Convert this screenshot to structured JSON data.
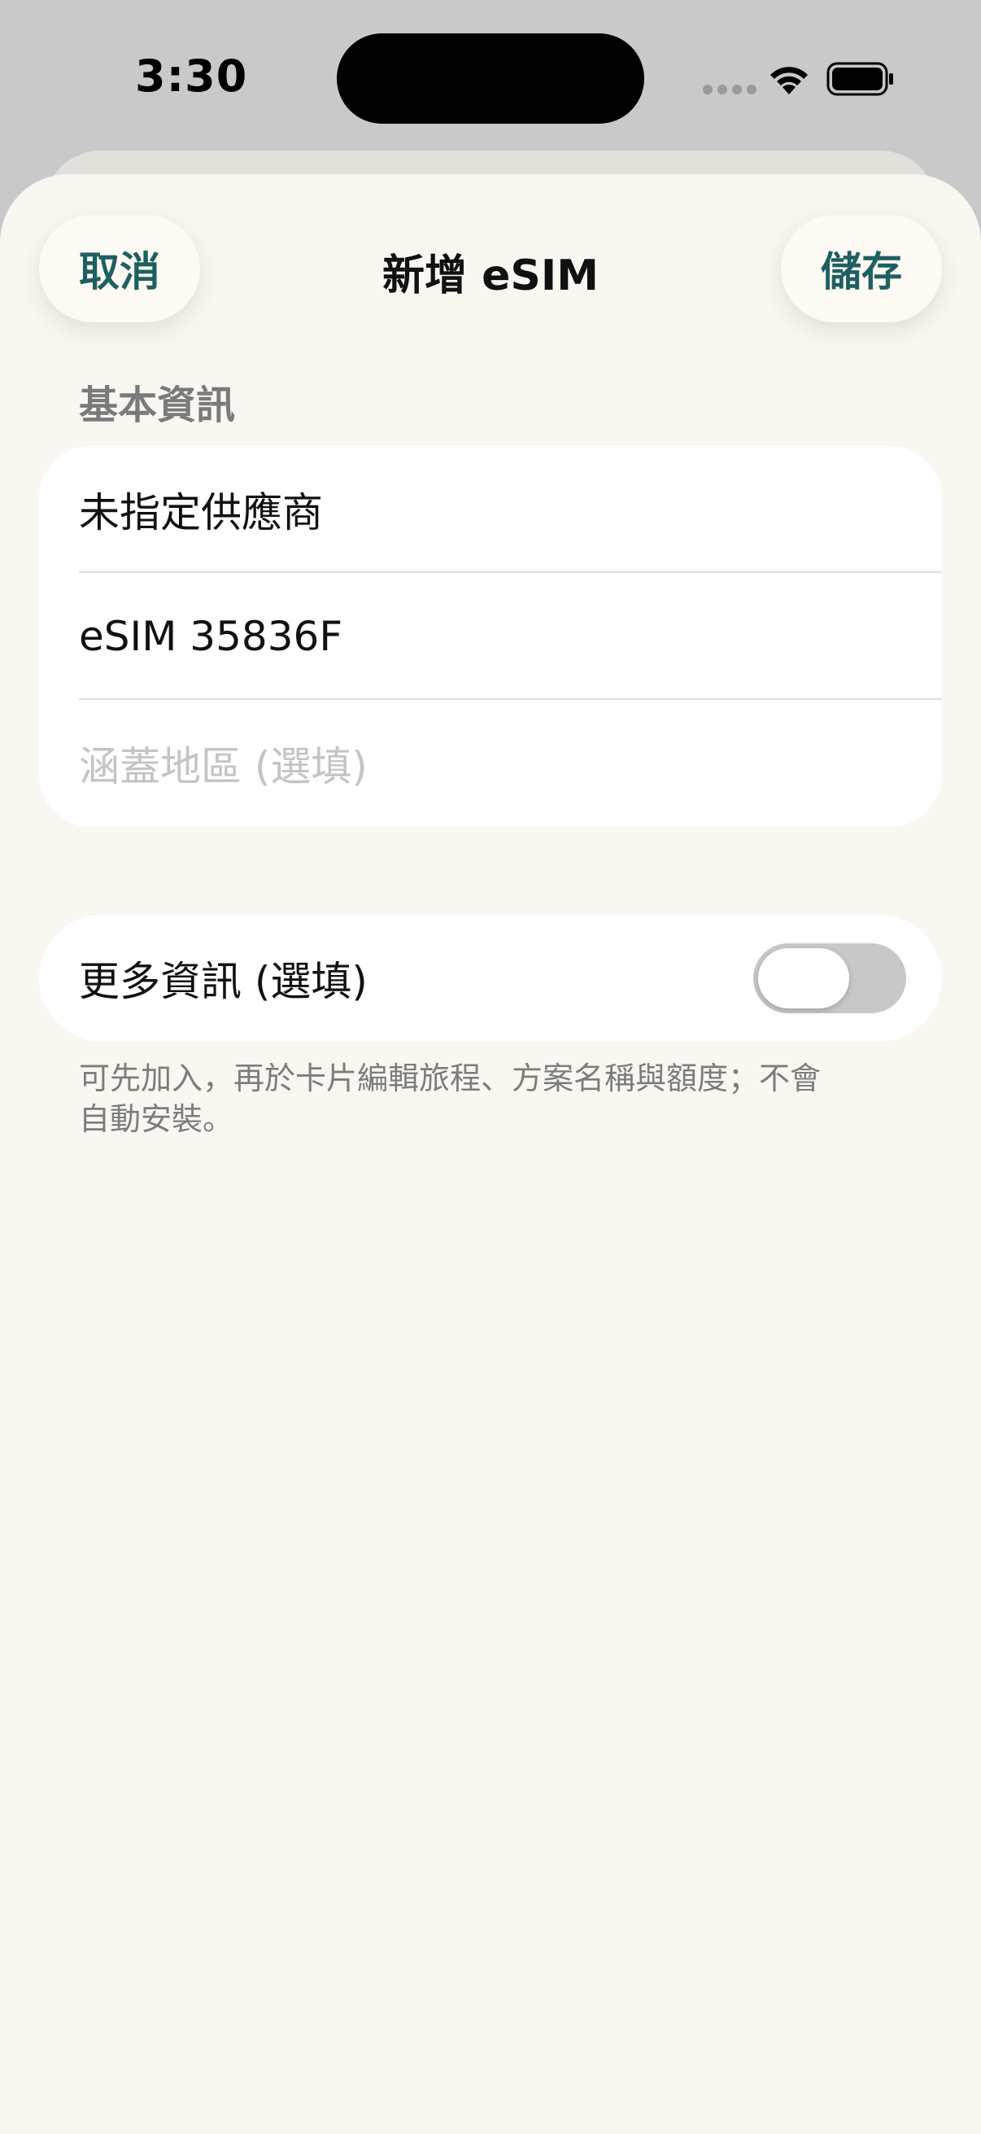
{
  "status_bar": {
    "time": "3:30"
  },
  "nav": {
    "cancel_label": "取消",
    "title": "新增 eSIM",
    "save_label": "儲存"
  },
  "basic_info": {
    "section_title": "基本資訊",
    "provider_value": "未指定供應商",
    "name_value": "eSIM 35836F",
    "coverage_placeholder": "涵蓋地區 (選填)"
  },
  "more_info": {
    "label": "更多資訊 (選填)",
    "toggle_on": false,
    "footnote_line1": "可先加入，再於卡片編輯旅程、方案名稱與額度；不會",
    "footnote_line2": "自動安裝。"
  },
  "colors": {
    "accent": "#1f5f62",
    "sheet_background": "#f9f7f0",
    "toggle_off": "#c8c8c8"
  },
  "icons": [
    "wifi-icon",
    "battery-icon",
    "cellular-signal-icon"
  ]
}
